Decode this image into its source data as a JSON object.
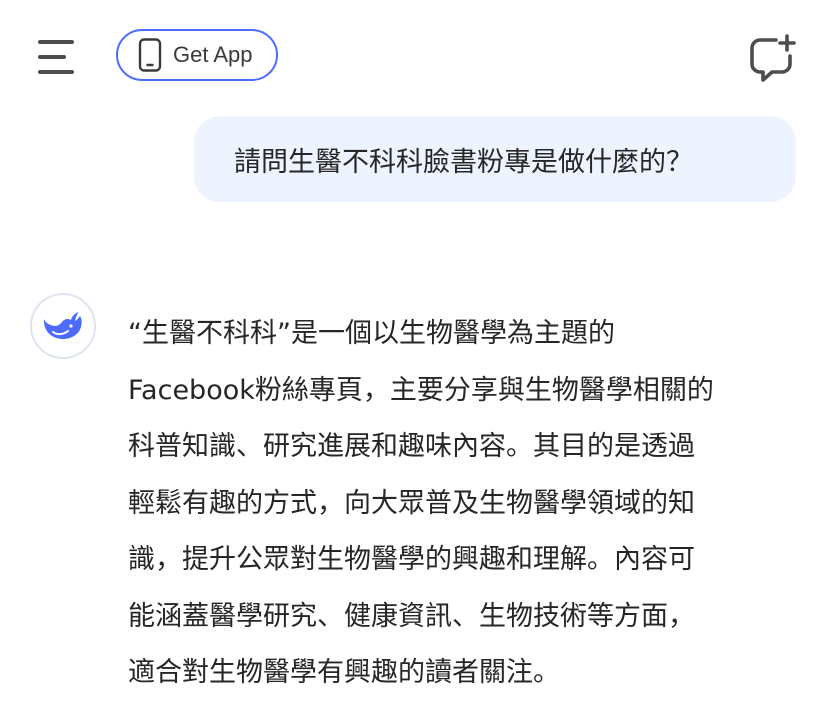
{
  "header": {
    "get_app_label": "Get App",
    "icons": {
      "menu": "menu-icon",
      "phone": "phone-icon",
      "new_chat": "new-chat-icon"
    }
  },
  "conversation": {
    "user_message": "請問生醫不科科臉書粉專是做什麼的？",
    "assistant_avatar": "deepseek-whale-logo",
    "assistant_lines": [
      "“生醫不科科”是一個以生物醫學為主題的",
      "Facebook粉絲專頁，主要分享與生物醫學相關的",
      "科普知識、研究進展和趣味內容。其目的是透過",
      "輕鬆有趣的方式，向大眾普及生物醫學領域的知",
      "識，提升公眾對生物醫學的興趣和理解。內容可",
      "能涵蓋醫學研究、健康資訊、生物技術等方面，",
      "適合對生物醫學有興趣的讀者關注。"
    ]
  },
  "colors": {
    "accent": "#4d6bfe",
    "user_bubble_bg": "#eef4ff",
    "text": "#262626",
    "icon": "#4d4d4d"
  }
}
